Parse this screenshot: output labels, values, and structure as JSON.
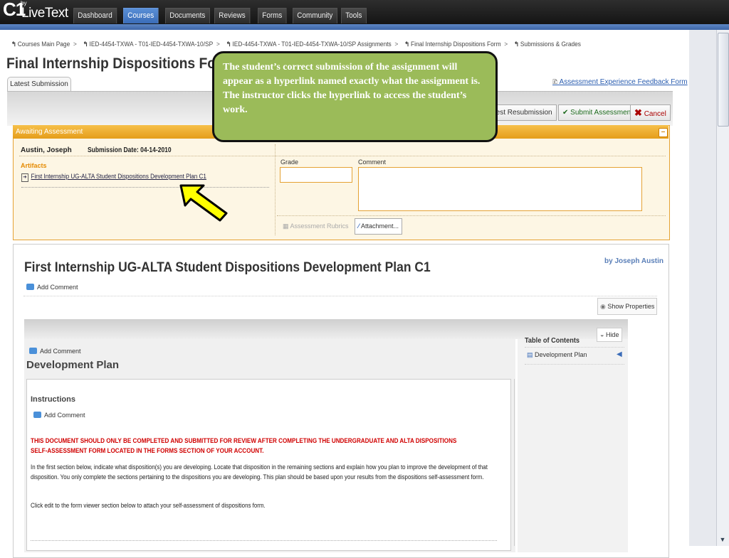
{
  "nav": {
    "logo_mark": "C1",
    "logo_by": "by",
    "logo_text": "LiveText",
    "tabs": [
      {
        "label": "Dashboard"
      },
      {
        "label": "Courses"
      },
      {
        "label": "Documents"
      },
      {
        "label": "Reviews"
      },
      {
        "label": "Forms"
      },
      {
        "label": "Community"
      },
      {
        "label": "Tools"
      }
    ],
    "active_tab": "Courses"
  },
  "breadcrumb": [
    "Courses Main Page",
    "IED-4454-TXWA - T01-IED-4454-TXWA-10/SP",
    "IED-4454-TXWA - T01-IED-4454-TXWA-10/SP Assignments",
    "Final Internship Dispositions Form",
    "Submissions & Grades"
  ],
  "page_title": "Final Internship Dispositions Form",
  "tab_latest": "Latest Submission",
  "feedback_link": "Assessment Experience Feedback Form",
  "buttons": {
    "request_resubmission": "equest Resubmission",
    "submit_assessment": "Submit Assessment",
    "cancel": "Cancel"
  },
  "awaiting": {
    "header": "Awaiting Assessment",
    "student": "Austin, Joseph",
    "submission_date": "Submission Date: 04-14-2010",
    "artifacts_label": "Artifacts",
    "artifact_link": "First Internship UG-ALTA Student Dispositions Development Plan C1",
    "grade_label": "Grade",
    "comment_label": "Comment",
    "rubrics_button": "Assessment Rubrics",
    "attachment_button": "Attachment..."
  },
  "callout": "The student’s correct submission of the assignment will appear as a hyperlink named exactly what the assignment is.  The instructor clicks the hyperlink to access the student’s work.",
  "document": {
    "title": "First Internship UG-ALTA Student Dispositions Development Plan C1",
    "byline": "by Joseph Austin",
    "add_comment": "Add Comment",
    "show_properties": "Show Properties",
    "section_title": "Development Plan",
    "toc_title": "Table of Contents",
    "toc_hide": "Hide",
    "toc_item": "Development Plan",
    "instructions_title": "Instructions",
    "red_notice": "THIS DOCUMENT SHOULD ONLY BE COMPLETED AND SUBMITTED FOR REVIEW AFTER COMPLETING THE UNDERGRADUATE AND ALTA DISPOSITIONS SELF-ASSESSMENT FORM LOCATED IN THE FORMS SECTION OF YOUR ACCOUNT.",
    "body_1": "In the first section below, indicate what disposition(s) you are developing.  Locate that disposition in the remaining sections and explain how you plan to improve the development of that disposition.  You only complete the sections pertaining to the dispositions you are developing.  This plan should be based upon your results from the dispositions self-assessment form.",
    "body_2": "Click edit to the form viewer section below to attach your self-assessment of dispositions form."
  },
  "colors": {
    "accent_blue": "#3a6cb8",
    "awaiting_orange": "#e59d1a",
    "callout_green": "#9bbb59",
    "arrow_yellow": "#ffff00",
    "notice_red": "#d00000"
  }
}
